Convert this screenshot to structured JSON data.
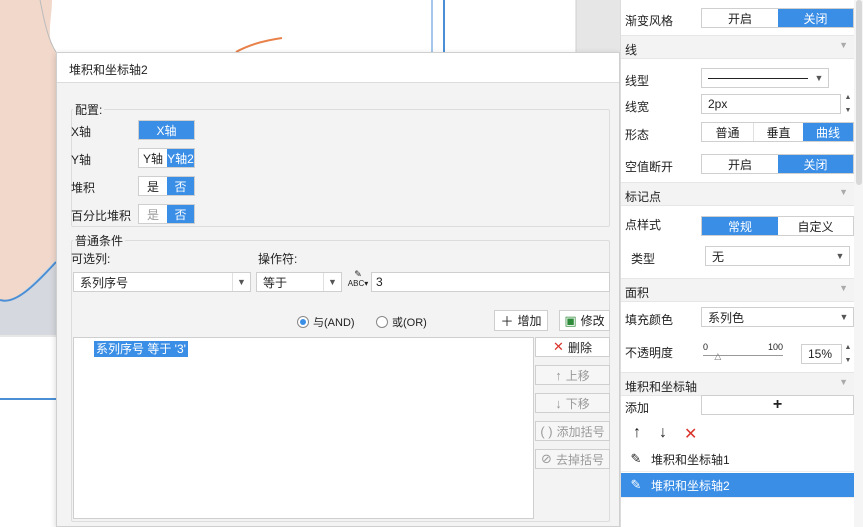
{
  "dialog": {
    "title": "堆积和坐标轴2",
    "config_label": "配置:",
    "x_axis": {
      "label": "X轴",
      "option": "X轴"
    },
    "y_axis": {
      "label": "Y轴",
      "options": [
        "Y轴",
        "Y轴2"
      ],
      "selected": "Y轴2"
    },
    "stack": {
      "label": "堆积",
      "yes": "是",
      "no": "否",
      "selected": "否"
    },
    "percent_stack": {
      "label": "百分比堆积",
      "yes": "是",
      "no": "否",
      "selected": "否"
    },
    "condition_label": "普通条件",
    "field_label": "可选列:",
    "field_value": "系列序号",
    "operator_label": "操作符:",
    "operator_value": "等于",
    "abc_icon": "abc-formula-icon",
    "value_input": "3",
    "radio_and": "与(AND)",
    "radio_or": "或(OR)",
    "radio_selected": "and",
    "btn_add": "增加",
    "btn_modify": "修改",
    "btn_delete": "删除",
    "btn_up": "上移",
    "btn_down": "下移",
    "btn_add_bracket": "添加括号",
    "btn_remove_bracket": "去掉括号",
    "condition_item": "系列序号 等于 '3'"
  },
  "panel": {
    "gradient_label": "渐变风格",
    "gradient_on": "开启",
    "gradient_off": "关闭",
    "line_section": "线",
    "line_type_label": "线型",
    "line_width_label": "线宽",
    "line_width_value": "2px",
    "shape_label": "形态",
    "shape_options": [
      "普通",
      "垂直",
      "曲线"
    ],
    "shape_selected": "曲线",
    "null_break_label": "空值断开",
    "null_on": "开启",
    "null_off": "关闭",
    "marker_section": "标记点",
    "marker_style_label": "点样式",
    "marker_regular": "常规",
    "marker_custom": "自定义",
    "type_label": "类型",
    "type_value": "无",
    "area_section": "面积",
    "fill_color_label": "填充颜色",
    "fill_color_value": "系列色",
    "opacity_label": "不透明度",
    "slider_min": "0",
    "slider_max": "100",
    "opacity_value": "15%",
    "opacity_level": 15,
    "stack_axis_section": "堆积和坐标轴",
    "add_label": "添加",
    "axis_items": [
      "堆积和坐标轴1",
      "堆积和坐标轴2"
    ],
    "selected_axis_item": "堆积和坐标轴2"
  },
  "colors": {
    "accent": "#3a8ee6",
    "delete_red": "#d9342b",
    "chart_area": "#f1d8cb",
    "chart_line_orange": "#e8824a",
    "chart_line_blue": "#4a8fd6"
  }
}
